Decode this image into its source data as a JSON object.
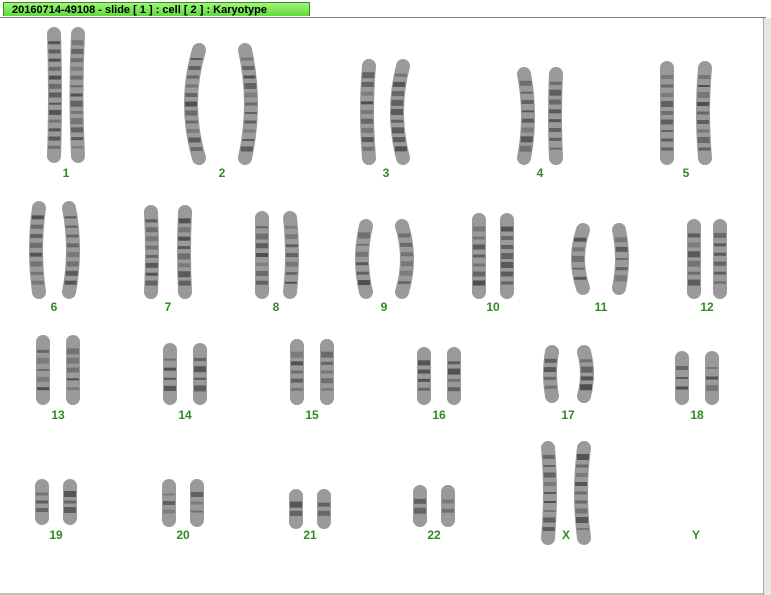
{
  "window": {
    "tab_title": "20160714-49108 - slide [ 1 ] : cell [ 2 ] : Karyotype"
  },
  "karyotype": {
    "chromosomes": [
      {
        "id": "1",
        "label": "1"
      },
      {
        "id": "2",
        "label": "2"
      },
      {
        "id": "3",
        "label": "3"
      },
      {
        "id": "4",
        "label": "4"
      },
      {
        "id": "5",
        "label": "5"
      },
      {
        "id": "6",
        "label": "6"
      },
      {
        "id": "7",
        "label": "7"
      },
      {
        "id": "8",
        "label": "8"
      },
      {
        "id": "9",
        "label": "9"
      },
      {
        "id": "10",
        "label": "10"
      },
      {
        "id": "11",
        "label": "11"
      },
      {
        "id": "12",
        "label": "12"
      },
      {
        "id": "13",
        "label": "13"
      },
      {
        "id": "14",
        "label": "14"
      },
      {
        "id": "15",
        "label": "15"
      },
      {
        "id": "16",
        "label": "16"
      },
      {
        "id": "17",
        "label": "17"
      },
      {
        "id": "18",
        "label": "18"
      },
      {
        "id": "19",
        "label": "19"
      },
      {
        "id": "20",
        "label": "20"
      },
      {
        "id": "21",
        "label": "21"
      },
      {
        "id": "22",
        "label": "22"
      },
      {
        "id": "X",
        "label": "X"
      },
      {
        "id": "Y",
        "label": "Y"
      }
    ],
    "label_color": "#2e8b22",
    "chromosome_color": "#4a4a4a"
  }
}
